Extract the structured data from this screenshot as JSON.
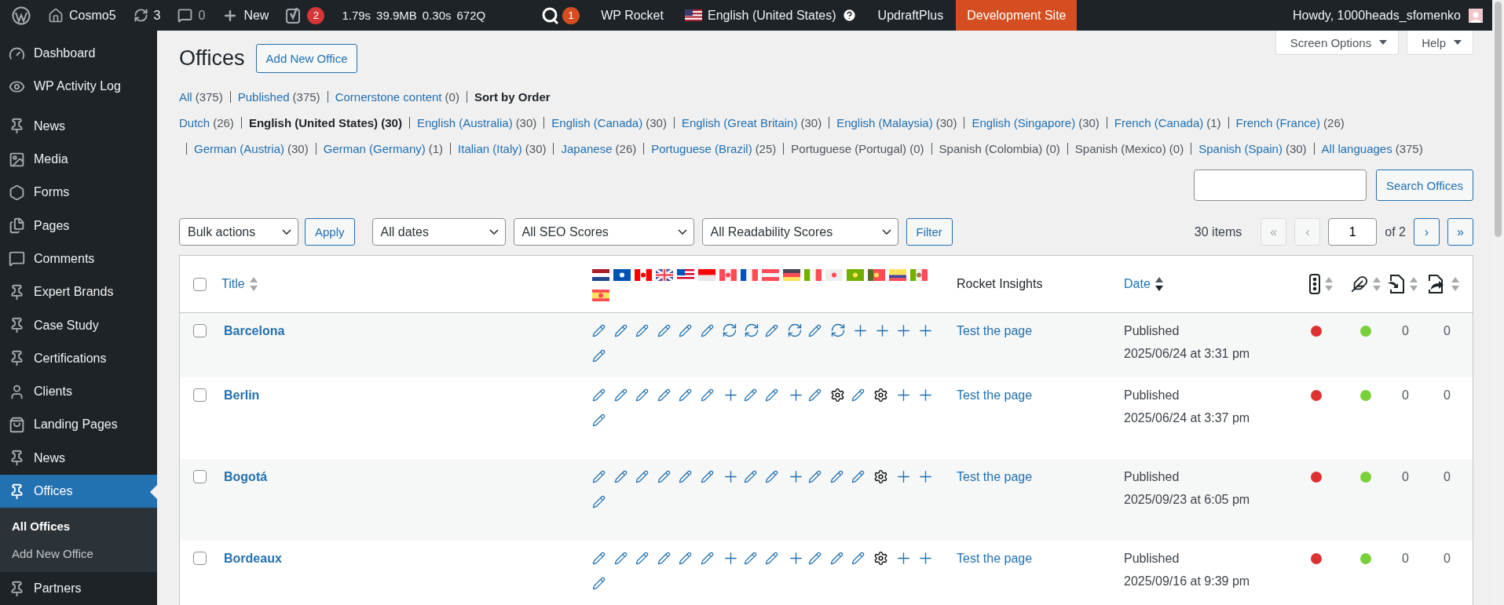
{
  "admin_bar": {
    "items": [
      {
        "kind": "wp-logo"
      },
      {
        "kind": "home",
        "label": "Cosmo5"
      },
      {
        "kind": "updates",
        "label": "3"
      },
      {
        "kind": "comments",
        "label": "0"
      },
      {
        "kind": "new",
        "label": "New"
      },
      {
        "kind": "yoast",
        "badge": "2"
      },
      {
        "kind": "metrics",
        "values": [
          "1.79s",
          "39.9MB",
          "0.30s",
          "672Q"
        ]
      },
      {
        "kind": "rocket-q",
        "badge": "1"
      },
      {
        "kind": "text",
        "label": "WP Rocket"
      },
      {
        "kind": "language",
        "label": "English (United States)"
      },
      {
        "kind": "text",
        "label": "UpdraftPlus"
      },
      {
        "kind": "environment",
        "label": "Development Site"
      }
    ],
    "greeting": "Howdy, 1000heads_sfomenko"
  },
  "sidebar": {
    "groups": [
      [
        {
          "label": "Dashboard",
          "kind": "dashboard",
          "selected": false
        },
        {
          "label": "WP Activity Log",
          "kind": "eye",
          "selected": false
        }
      ],
      [
        {
          "label": "News",
          "kind": "pin",
          "selected": false
        },
        {
          "label": "Media",
          "kind": "media",
          "selected": false
        },
        {
          "label": "Forms",
          "kind": "forms",
          "selected": false
        },
        {
          "label": "Pages",
          "kind": "pages",
          "selected": false
        },
        {
          "label": "Comments",
          "kind": "comments",
          "selected": false
        },
        {
          "label": "Expert Brands",
          "kind": "pin",
          "selected": false
        },
        {
          "label": "Case Study",
          "kind": "pin",
          "selected": false
        },
        {
          "label": "Certifications",
          "kind": "pin",
          "selected": false
        },
        {
          "label": "Clients",
          "kind": "person",
          "selected": false
        },
        {
          "label": "Landing Pages",
          "kind": "bag",
          "selected": false
        },
        {
          "label": "News",
          "kind": "pin",
          "selected": false
        },
        {
          "label": "Offices",
          "kind": "pin",
          "selected": true,
          "children": [
            {
              "label": "All Offices",
              "selected": true
            },
            {
              "label": "Add New Office",
              "selected": false
            }
          ]
        },
        {
          "label": "Partners",
          "kind": "pin",
          "selected": false
        }
      ]
    ]
  },
  "page": {
    "title": "Offices",
    "add_button": "Add New Office",
    "screen_buttons": [
      "Screen Options",
      "Help"
    ]
  },
  "views": [
    {
      "label": "All",
      "count": "(375)",
      "kind": "link"
    },
    {
      "label": "Published",
      "count": "(375)",
      "kind": "link"
    },
    {
      "label": "Cornerstone content",
      "count": "(0)",
      "kind": "link"
    },
    {
      "label": "Sort by Order",
      "kind": "current"
    }
  ],
  "language_lines": [
    [
      {
        "label": "Dutch",
        "count": "(26)",
        "kind": "link"
      },
      {
        "label": "English (United States) (30)",
        "kind": "current"
      },
      {
        "label": "English (Australia)",
        "count": "(30)",
        "kind": "link"
      },
      {
        "label": "English (Canada)",
        "count": "(30)",
        "kind": "link"
      },
      {
        "label": "English (Great Britain)",
        "count": "(30)",
        "kind": "link"
      },
      {
        "label": "English (Malaysia)",
        "count": "(30)",
        "kind": "link"
      },
      {
        "label": "English (Singapore)",
        "count": "(30)",
        "kind": "link"
      },
      {
        "label": "French (Canada)",
        "count": "(1)",
        "kind": "link"
      },
      {
        "label": "French (France)",
        "count": "(26)",
        "kind": "link"
      }
    ],
    [
      {
        "label": "German (Austria)",
        "count": "(30)",
        "kind": "link"
      },
      {
        "label": "German (Germany)",
        "count": "(1)",
        "kind": "link"
      },
      {
        "label": "Italian (Italy)",
        "count": "(30)",
        "kind": "link"
      },
      {
        "label": "Japanese",
        "count": "(26)",
        "kind": "link"
      },
      {
        "label": "Portuguese (Brazil)",
        "count": "(25)",
        "kind": "link"
      },
      {
        "label": "Portuguese (Portugal) (0)",
        "kind": "plain"
      },
      {
        "label": "Spanish (Colombia) (0)",
        "kind": "plain"
      },
      {
        "label": "Spanish (Mexico) (0)",
        "kind": "plain"
      },
      {
        "label": "Spanish (Spain)",
        "count": "(30)",
        "kind": "link"
      },
      {
        "label": "All languages",
        "count": "(375)",
        "kind": "link"
      }
    ]
  ],
  "search": {
    "button": "Search Offices"
  },
  "tablenav": {
    "bulk": "Bulk actions",
    "apply": "Apply",
    "filters": [
      "All dates",
      "All SEO Scores",
      "All Readability Scores"
    ],
    "filter_button": "Filter",
    "items": "30 items",
    "pages": [
      {
        "label": "«",
        "disabled": true
      },
      {
        "label": "‹",
        "disabled": true
      }
    ],
    "current_page": "1",
    "of": "of 2",
    "next_pages": [
      {
        "label": "›",
        "disabled": false
      },
      {
        "label": "»",
        "disabled": false
      }
    ]
  },
  "table": {
    "select_all_checked": false,
    "columns": {
      "title": {
        "label": "Title",
        "sorted": false
      },
      "insights": "Rocket Insights",
      "date": {
        "label": "Date",
        "sorted": true
      }
    },
    "rows": [
      {
        "checked": false,
        "title": "Barcelona",
        "statuses": [
          {
            "kind": "edit"
          },
          {
            "kind": "edit"
          },
          {
            "kind": "edit"
          },
          {
            "kind": "edit"
          },
          {
            "kind": "edit"
          },
          {
            "kind": "edit"
          },
          {
            "kind": "sync"
          },
          {
            "kind": "sync"
          },
          {
            "kind": "edit"
          },
          {
            "kind": "sync"
          },
          {
            "kind": "edit"
          },
          {
            "kind": "sync"
          },
          {
            "kind": "add"
          },
          {
            "kind": "add"
          },
          {
            "kind": "add"
          },
          {
            "kind": "add"
          },
          {
            "kind": "edit"
          }
        ],
        "insights": "Test the page",
        "status": "Published",
        "date": "2025/06/24 at 3:31 pm",
        "seo_score": {
          "color": "#dc3232"
        },
        "readability_score": {
          "color": "#7ad03a"
        },
        "links_in": "0",
        "links_out": "0"
      },
      {
        "checked": false,
        "title": "Berlin",
        "statuses": [
          {
            "kind": "edit"
          },
          {
            "kind": "edit"
          },
          {
            "kind": "edit"
          },
          {
            "kind": "edit"
          },
          {
            "kind": "edit"
          },
          {
            "kind": "edit"
          },
          {
            "kind": "add"
          },
          {
            "kind": "edit"
          },
          {
            "kind": "edit"
          },
          {
            "kind": "add"
          },
          {
            "kind": "edit"
          },
          {
            "kind": "settings"
          },
          {
            "kind": "edit"
          },
          {
            "kind": "settings"
          },
          {
            "kind": "add"
          },
          {
            "kind": "add"
          },
          {
            "kind": "edit"
          }
        ],
        "insights": "Test the page",
        "status": "Published",
        "date": "2025/06/24 at 3:37 pm",
        "seo_score": {
          "color": "#dc3232"
        },
        "readability_score": {
          "color": "#7ad03a"
        },
        "links_in": "0",
        "links_out": "0"
      },
      {
        "checked": false,
        "title": "Bogotá",
        "statuses": [
          {
            "kind": "edit"
          },
          {
            "kind": "edit"
          },
          {
            "kind": "edit"
          },
          {
            "kind": "edit"
          },
          {
            "kind": "edit"
          },
          {
            "kind": "edit"
          },
          {
            "kind": "add"
          },
          {
            "kind": "edit"
          },
          {
            "kind": "edit"
          },
          {
            "kind": "add"
          },
          {
            "kind": "edit"
          },
          {
            "kind": "edit"
          },
          {
            "kind": "edit"
          },
          {
            "kind": "settings"
          },
          {
            "kind": "add"
          },
          {
            "kind": "add"
          },
          {
            "kind": "edit"
          }
        ],
        "insights": "Test the page",
        "status": "Published",
        "date": "2025/09/23 at 6:05 pm",
        "seo_score": {
          "color": "#dc3232"
        },
        "readability_score": {
          "color": "#7ad03a"
        },
        "links_in": "0",
        "links_out": "0"
      },
      {
        "checked": false,
        "title": "Bordeaux",
        "statuses": [
          {
            "kind": "edit"
          },
          {
            "kind": "edit"
          },
          {
            "kind": "edit"
          },
          {
            "kind": "edit"
          },
          {
            "kind": "edit"
          },
          {
            "kind": "edit"
          },
          {
            "kind": "add"
          },
          {
            "kind": "edit"
          },
          {
            "kind": "edit"
          },
          {
            "kind": "add"
          },
          {
            "kind": "edit"
          },
          {
            "kind": "edit"
          },
          {
            "kind": "edit"
          },
          {
            "kind": "settings"
          },
          {
            "kind": "add"
          },
          {
            "kind": "add"
          },
          {
            "kind": "edit"
          }
        ],
        "insights": "Test the page",
        "status": "Published",
        "date": "2025/09/16 at 9:39 pm",
        "seo_score": {
          "color": "#dc3232"
        },
        "readability_score": {
          "color": "#7ad03a"
        },
        "links_in": "0",
        "links_out": "0"
      }
    ]
  }
}
